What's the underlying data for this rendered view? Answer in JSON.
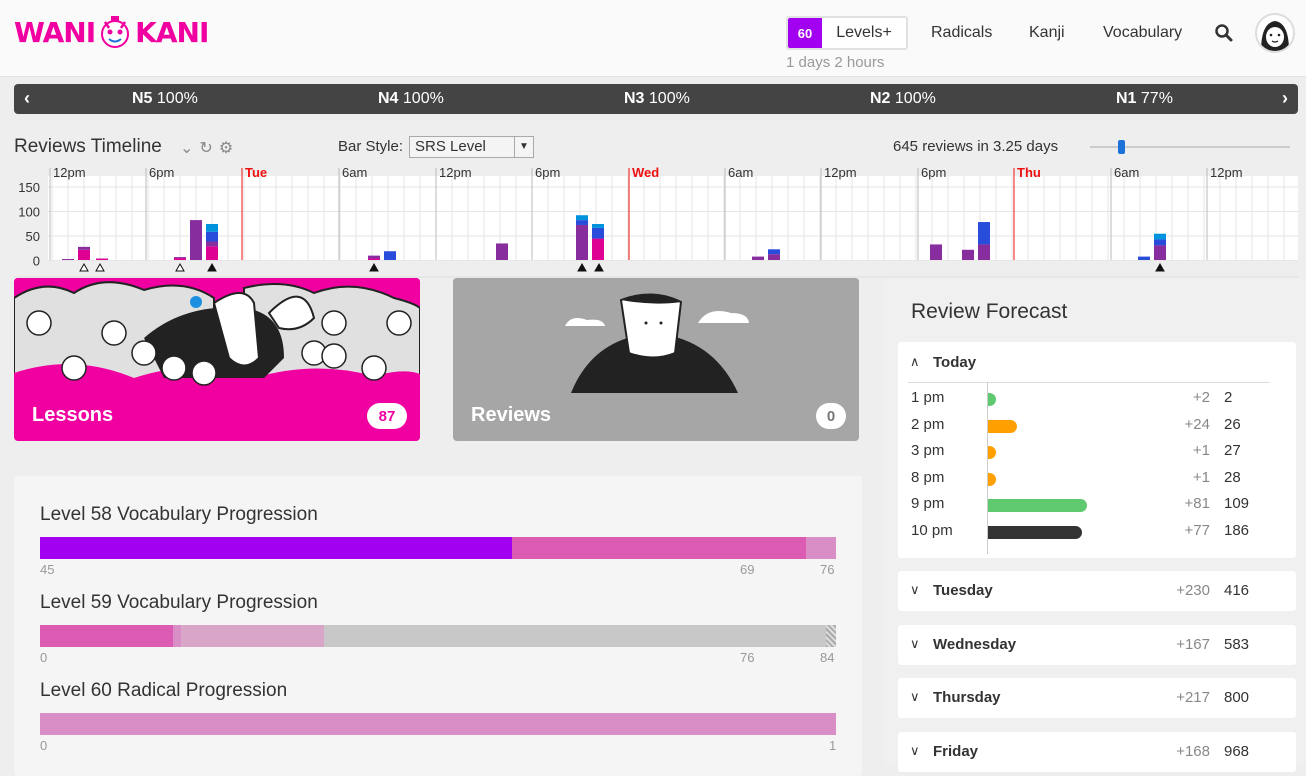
{
  "header": {
    "logo_left": "WANI",
    "logo_right": "KANI",
    "level_number": "60",
    "level_label": "Levels+",
    "time_until": "1 days 2 hours",
    "nav": [
      "Radicals",
      "Kanji",
      "Vocabulary"
    ]
  },
  "jlpt": [
    {
      "name": "N5",
      "pct": "100%"
    },
    {
      "name": "N4",
      "pct": "100%"
    },
    {
      "name": "N3",
      "pct": "100%"
    },
    {
      "name": "N2",
      "pct": "100%"
    },
    {
      "name": "N1",
      "pct": "77%"
    }
  ],
  "timeline": {
    "title": "Reviews Timeline",
    "bar_style_label": "Bar Style:",
    "bar_style_value": "SRS Level",
    "summary": "645 reviews in 3.25 days",
    "y_ticks": [
      "150",
      "100",
      "50",
      "0"
    ],
    "time_labels": [
      {
        "text": "12pm",
        "x": 0,
        "day": false
      },
      {
        "text": "6pm",
        "x": 96,
        "day": false
      },
      {
        "text": "Tue",
        "x": 192,
        "day": true
      },
      {
        "text": "6am",
        "x": 289,
        "day": false
      },
      {
        "text": "12pm",
        "x": 386,
        "day": false
      },
      {
        "text": "6pm",
        "x": 482,
        "day": false
      },
      {
        "text": "Wed",
        "x": 579,
        "day": true
      },
      {
        "text": "6am",
        "x": 675,
        "day": false
      },
      {
        "text": "12pm",
        "x": 771,
        "day": false
      },
      {
        "text": "6pm",
        "x": 868,
        "day": false
      },
      {
        "text": "Thu",
        "x": 964,
        "day": true
      },
      {
        "text": "6am",
        "x": 1061,
        "day": false
      },
      {
        "text": "12pm",
        "x": 1157,
        "day": false
      }
    ],
    "ymax": 150,
    "colors": {
      "apprentice": "#dd0093",
      "guru": "#882d9e",
      "master": "#294ddb",
      "enlightened": "#0093dd"
    }
  },
  "lessons": {
    "label": "Lessons",
    "count": "87"
  },
  "reviews": {
    "label": "Reviews",
    "count": "0"
  },
  "progression": [
    {
      "title": "Level 58 Vocabulary Progression",
      "ticks": [
        "45",
        "69",
        "76"
      ]
    },
    {
      "title": "Level 59 Vocabulary Progression",
      "ticks": [
        "0",
        "76",
        "84"
      ]
    },
    {
      "title": "Level 60 Radical Progression",
      "ticks": [
        "0",
        "1"
      ]
    }
  ],
  "forecast": {
    "title": "Review Forecast",
    "today_label": "Today",
    "today": [
      {
        "time": "1 pm",
        "inc": "+2",
        "total": "2",
        "color": "#5ec96f",
        "value": 2
      },
      {
        "time": "2 pm",
        "inc": "+24",
        "total": "26",
        "color": "#ffa000",
        "value": 24
      },
      {
        "time": "3 pm",
        "inc": "+1",
        "total": "27",
        "color": "#ffa000",
        "value": 1
      },
      {
        "time": "8 pm",
        "inc": "+1",
        "total": "28",
        "color": "#ffa000",
        "value": 1
      },
      {
        "time": "9 pm",
        "inc": "+81",
        "total": "109",
        "color": "#5ec96f",
        "value": 81
      },
      {
        "time": "10 pm",
        "inc": "+77",
        "total": "186",
        "color": "#333333",
        "value": 77
      }
    ],
    "days": [
      {
        "day": "Tuesday",
        "inc": "+230",
        "total": "416"
      },
      {
        "day": "Wednesday",
        "inc": "+167",
        "total": "583"
      },
      {
        "day": "Thursday",
        "inc": "+217",
        "total": "800"
      },
      {
        "day": "Friday",
        "inc": "+168",
        "total": "968"
      }
    ]
  }
}
